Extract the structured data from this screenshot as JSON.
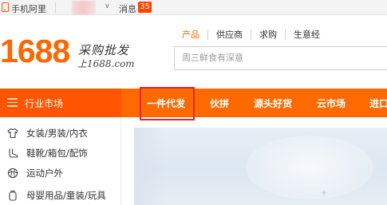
{
  "topbar": {
    "mobile_label": "手机阿里",
    "messages_label": "消息",
    "messages_count": "35",
    "account_chevron": "∨"
  },
  "logo": {
    "number": "1688",
    "slogan": "采购批发",
    "domain": "上1688.com"
  },
  "search": {
    "tabs": [
      "产品",
      "供应商",
      "求购",
      "生意经"
    ],
    "active_tab": "产品",
    "placeholder": "周三鲜食有深意"
  },
  "nav": {
    "category_header": "行业市场",
    "items": [
      "一件代发",
      "伙拼",
      "源头好货",
      "云市场",
      "进口"
    ],
    "highlighted_item": "一件代发"
  },
  "categories": [
    {
      "label": "女装/男装/内衣",
      "icon": "shirt-icon"
    },
    {
      "label": "鞋靴/箱包/配饰",
      "icon": "boot-icon"
    },
    {
      "label": "运动户外",
      "icon": "sports-icon"
    },
    {
      "label": "母婴用品/童装/玩具",
      "icon": "baby-icon"
    }
  ],
  "colors": {
    "brand": "#ff6a00",
    "category_header": "#ff5500",
    "highlight_border": "#e0262b",
    "badge": "#ff4400"
  }
}
